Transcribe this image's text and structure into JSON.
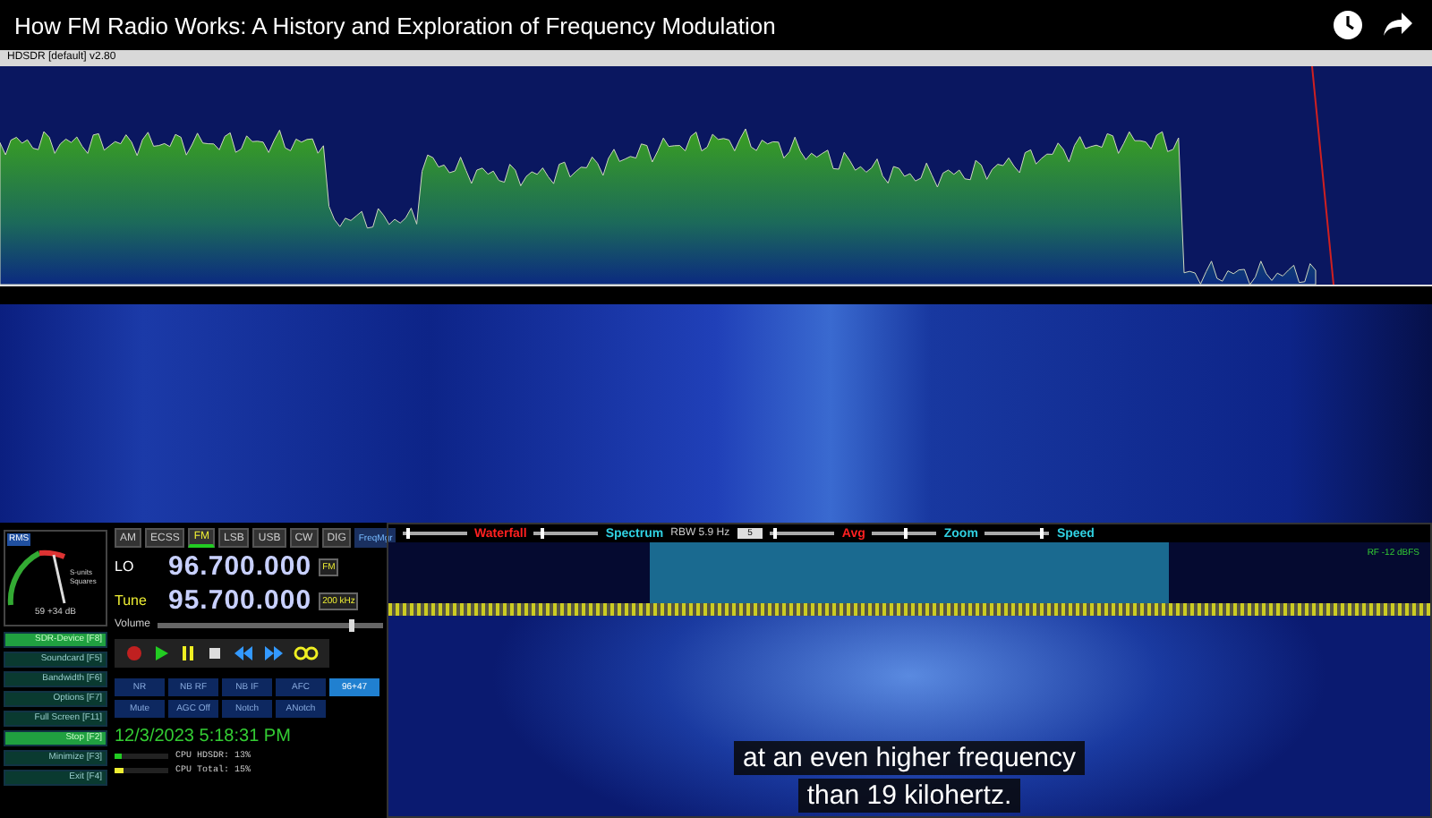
{
  "video_title": "How FM Radio Works: A History and Exploration of Frequency Modulation",
  "app": {
    "title": "HDSDR [default] v2.80",
    "smeter": {
      "badge": "RMS",
      "label": "S-units Squares",
      "reading": "59 +34 dB"
    },
    "modes": [
      {
        "label": "AM",
        "selected": false
      },
      {
        "label": "ECSS",
        "selected": false
      },
      {
        "label": "FM",
        "selected": true
      },
      {
        "label": "LSB",
        "selected": false
      },
      {
        "label": "USB",
        "selected": false
      },
      {
        "label": "CW",
        "selected": false
      },
      {
        "label": "DIG",
        "selected": false
      }
    ],
    "freq_mgr": "FreqMgr",
    "lo": {
      "label": "LO",
      "value": "96.700.000",
      "select": "FM"
    },
    "tune": {
      "label": "Tune",
      "value": "95.700.000",
      "select": "200 kHz"
    },
    "volume": {
      "label": "Volume",
      "level": 0.85
    },
    "side_buttons": [
      {
        "label": "SDR-Device [F8]",
        "selected": true
      },
      {
        "label": "Soundcard [F5]",
        "selected": false
      },
      {
        "label": "Bandwidth [F6]",
        "selected": false
      },
      {
        "label": "Options [F7]",
        "selected": false
      },
      {
        "label": "Full Screen [F11]",
        "selected": false
      },
      {
        "label": "Stop [F2]",
        "selected": true
      },
      {
        "label": "Minimize [F3]",
        "selected": false
      },
      {
        "label": "Exit [F4]",
        "selected": false
      }
    ],
    "dsp_buttons": [
      {
        "label": "NR",
        "selected": false
      },
      {
        "label": "NB RF",
        "selected": false
      },
      {
        "label": "NB IF",
        "selected": false
      },
      {
        "label": "AFC",
        "selected": false
      },
      {
        "label": "96+47",
        "selected": true
      },
      {
        "label": "Mute",
        "selected": false
      },
      {
        "label": "AGC Off",
        "selected": false
      },
      {
        "label": "Notch",
        "selected": false
      },
      {
        "label": "ANotch",
        "selected": false
      }
    ],
    "clock": "12/3/2023 5:18:31 PM",
    "cpu": [
      {
        "label": "CPU HDSDR: 13%",
        "level": 0.13
      },
      {
        "label": "CPU Total: 15%",
        "level": 0.15
      }
    ],
    "sliders": [
      {
        "label": "Waterfall",
        "color": "#ff2020",
        "level": 0.05
      },
      {
        "label": "Spectrum",
        "color": "#30d0e0",
        "level": 0.1
      },
      {
        "label": "Avg",
        "color": "#ff2020",
        "level": 0.05
      },
      {
        "label": "Zoom",
        "color": "#30d0e0",
        "level": 0.5
      },
      {
        "label": "Speed",
        "color": "#30d0e0",
        "level": 0.85
      }
    ],
    "rbw": "RBW 5.9 Hz",
    "avg_value": "5",
    "rf_level": "RF -12 dBFS"
  },
  "subtitles": [
    "at an even higher frequency",
    "than 19 kilohertz."
  ]
}
